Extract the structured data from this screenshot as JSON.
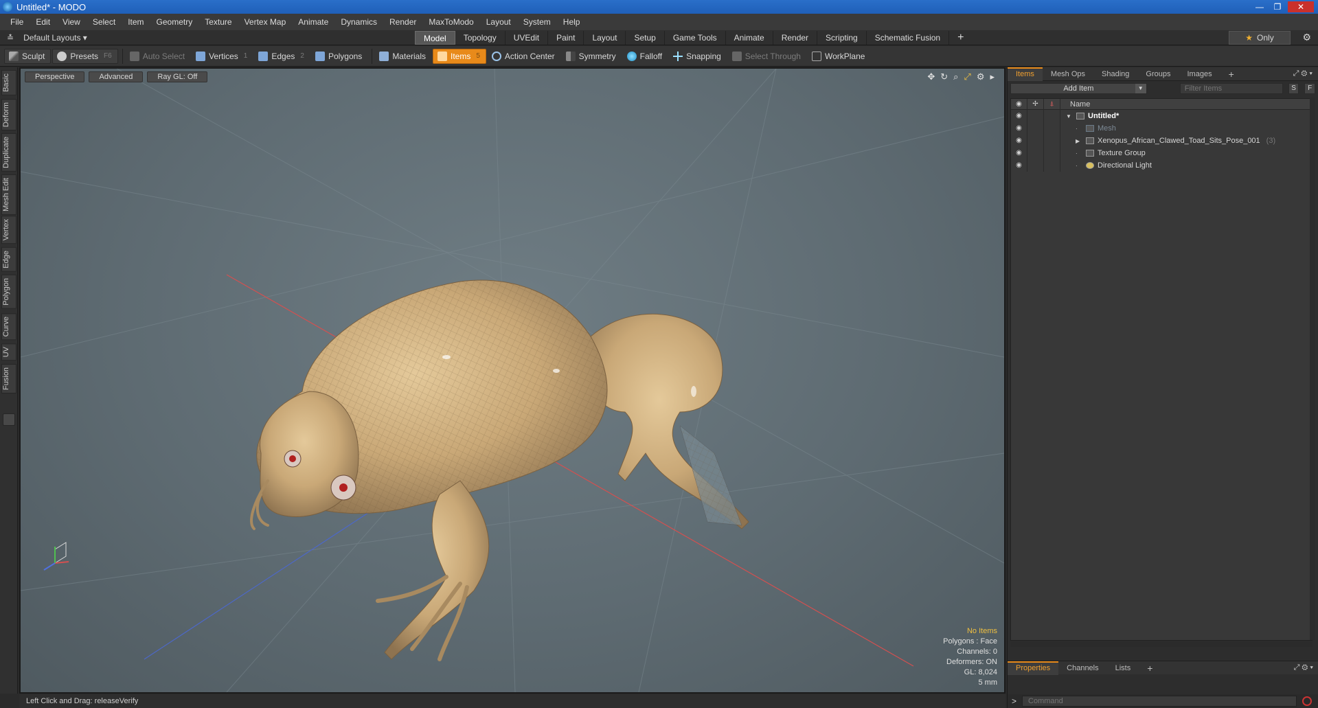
{
  "window": {
    "title": "Untitled* - MODO",
    "controls": [
      "—",
      "❐",
      "✕"
    ]
  },
  "menu": [
    "File",
    "Edit",
    "View",
    "Select",
    "Item",
    "Geometry",
    "Texture",
    "Vertex Map",
    "Animate",
    "Dynamics",
    "Render",
    "MaxToModo",
    "Layout",
    "System",
    "Help"
  ],
  "layout": {
    "selector": "Default Layouts ▾",
    "tabs": [
      "Model",
      "Topology",
      "UVEdit",
      "Paint",
      "Layout",
      "Setup",
      "Game Tools",
      "Animate",
      "Render",
      "Scripting",
      "Schematic Fusion"
    ],
    "active_tab": "Model",
    "plus": "+",
    "only_label": "Only"
  },
  "toolbar": {
    "sculpt": "Sculpt",
    "presets": "Presets",
    "presets_key": "F6",
    "auto_select": "Auto Select",
    "vertices": "Vertices",
    "vertices_key": "1",
    "edges": "Edges",
    "edges_key": "2",
    "polygons": "Polygons",
    "materials": "Materials",
    "items": "Items",
    "items_key": "5",
    "action_center": "Action Center",
    "symmetry": "Symmetry",
    "falloff": "Falloff",
    "snapping": "Snapping",
    "select_through": "Select Through",
    "workplane": "WorkPlane"
  },
  "left_tabs": [
    "Basic",
    "Deform",
    "Duplicate",
    "Mesh Edit",
    "Vertex",
    "Edge",
    "Polygon",
    "Curve",
    "UV",
    "Fusion"
  ],
  "viewport": {
    "view": "Perspective",
    "mode": "Advanced",
    "raygl": "Ray GL: Off",
    "stats": {
      "no_items": "No Items",
      "polygons": "Polygons : Face",
      "channels": "Channels: 0",
      "deformers": "Deformers: ON",
      "gl": "GL: 8,024",
      "scale": "5 mm"
    }
  },
  "status": "Left Click and Drag:   releaseVerify",
  "items_panel": {
    "tabs": [
      "Items",
      "Mesh Ops",
      "Shading",
      "Groups",
      "Images"
    ],
    "active_tab": "Items",
    "add_item": "Add Item",
    "filter_placeholder": "Filter Items",
    "s_btn": "S",
    "f_btn": "F",
    "name_header": "Name",
    "tree": [
      {
        "name": "Untitled*",
        "kind": "root"
      },
      {
        "name": "Mesh",
        "kind": "dim"
      },
      {
        "name": "Xenopus_African_Clawed_Toad_Sits_Pose_001",
        "count": "(3)",
        "kind": "group"
      },
      {
        "name": "Texture Group",
        "kind": "normal"
      },
      {
        "name": "Directional Light",
        "kind": "normal"
      }
    ]
  },
  "properties_panel": {
    "tabs": [
      "Properties",
      "Channels",
      "Lists"
    ],
    "active_tab": "Properties"
  },
  "command": {
    "prompt": ">",
    "placeholder": "Command"
  },
  "colors": {
    "accent": "#e88a1a",
    "viewport_bg": "#5e6b72",
    "frog": "#c9a877"
  }
}
